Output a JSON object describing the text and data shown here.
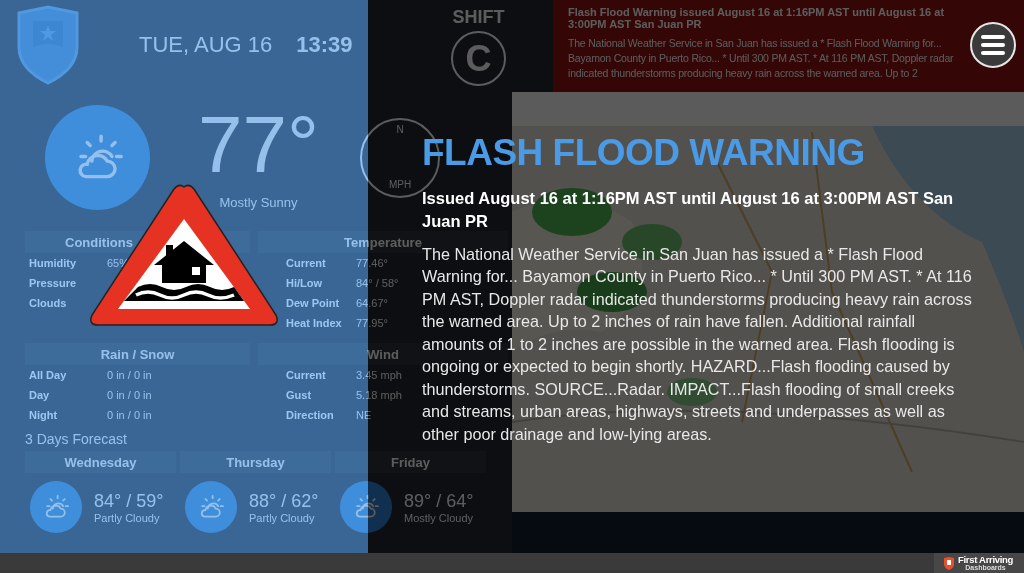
{
  "dashboard": {
    "date": "TUE, AUG 16",
    "time": "13:39",
    "shift": {
      "label": "SHIFT",
      "value": "C"
    },
    "current": {
      "temperature": "77°",
      "summary": "Mostly Sunny"
    },
    "compass": {
      "direction": "N",
      "unit": "MPH"
    },
    "sections": [
      {
        "title": "Conditions",
        "rows": [
          {
            "label": "Humidity",
            "value": "65%"
          },
          {
            "label": "Pressure"
          },
          {
            "label": "Clouds"
          }
        ]
      },
      {
        "title": "Temperature",
        "rows": [
          {
            "label": "Current",
            "value": "77.46°"
          },
          {
            "label": "Hi/Low",
            "value": "84° / 58°"
          },
          {
            "label": "Dew Point",
            "value": "64.67°"
          },
          {
            "label": "Heat Index",
            "value": "77.95°"
          }
        ]
      },
      {
        "title": "Rain / Snow",
        "rows": [
          {
            "label": "All Day",
            "value": "0 in / 0 in"
          },
          {
            "label": "Day",
            "value": "0 in / 0 in"
          },
          {
            "label": "Night",
            "value": "0 in / 0 in"
          }
        ]
      },
      {
        "title": "Wind",
        "rows": [
          {
            "label": "Current",
            "value": "3.45 mph"
          },
          {
            "label": "Gust",
            "value": "5.18 mph"
          },
          {
            "label": "Direction",
            "value": "NE"
          }
        ]
      }
    ],
    "forecast_title": "3 Days Forecast",
    "forecast": [
      {
        "day": "Wednesday",
        "temps": "84° / 59°",
        "summary": "Partly Cloudy"
      },
      {
        "day": "Thursday",
        "temps": "88° / 62°",
        "summary": "Partly Cloudy"
      },
      {
        "day": "Friday",
        "temps": "89° / 64°",
        "summary": "Mostly Cloudy"
      }
    ],
    "alert_ticker": {
      "title": "Flash Flood Warning issued August 16 at 1:16PM AST until August 16 at 3:00PM AST San Juan PR",
      "text": "The National Weather Service in San Juan has issued a * Flash Flood Warning for... Bayamon County in Puerto Rico... * Until 300 PM AST. * At 116 PM AST, Doppler radar indicated thunderstorms producing heavy rain across the warned area. Up to 2"
    }
  },
  "alert": {
    "title": "FLASH FLOOD WARNING",
    "issued": "Issued August 16 at 1:16PM AST until August 16 at 3:00PM AST San Juan PR",
    "description": "The National Weather Service in San Juan has issued a * Flash Flood Warning for... Bayamon County in Puerto Rico... * Until 300 PM AST. * At 116 PM AST, Doppler radar indicated thunderstorms producing heavy rain across the warned area. Up to 2 inches of rain have fallen. Additional rainfall amounts of 1 to 2 inches are possible in the warned area. Flash flooding is ongoing or expected to begin shortly. HAZARD...Flash flooding caused by thunderstorms. SOURCE...Radar. IMPACT...Flash flooding of small creeks and streams, urban areas, highways, streets and underpasses as well as other poor drainage and low-lying areas."
  },
  "footer": {
    "brand": "First Arriving",
    "tagline": "Dashboards"
  }
}
